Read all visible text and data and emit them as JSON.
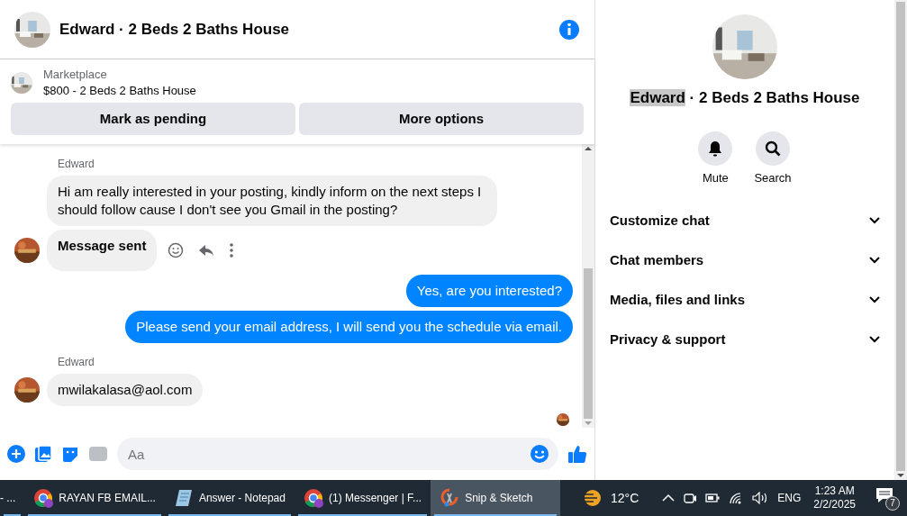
{
  "conversation": {
    "title": "Edward · 2 Beds 2 Baths House",
    "listing": {
      "source": "Marketplace",
      "summary": "$800 - 2 Beds 2 Baths House"
    },
    "buttons": [
      "Mark as pending",
      "More options"
    ]
  },
  "messages": [
    {
      "kind": "received",
      "sender": "Edward",
      "avatar": false,
      "actions": false,
      "text": "Hi am really interested in your posting, kindly inform on the next steps I should follow cause I don't see you Gmail in the  posting?"
    },
    {
      "kind": "received_bold",
      "avatar": true,
      "actions": true,
      "text": "Message sent"
    },
    {
      "kind": "sent",
      "text": "Yes, are you interested?"
    },
    {
      "kind": "sent",
      "text": "Please send your email address, I will send you the schedule via email."
    },
    {
      "kind": "received",
      "sender": "Edward",
      "avatar": true,
      "actions": false,
      "text": "mwilakalasa@aol.com"
    }
  ],
  "seen": true,
  "composer": {
    "placeholder": "Aa"
  },
  "details": {
    "name": "Edward",
    "name_selected": true,
    "rest": " · 2 Beds 2 Baths House",
    "actions": [
      {
        "label": "Mute",
        "kind": "bell"
      },
      {
        "label": "Search",
        "kind": "search"
      }
    ],
    "sections": [
      {
        "label": "Customize chat",
        "expanded": false
      },
      {
        "label": "Chat members",
        "expanded": false
      },
      {
        "label": "Media, files and links",
        "expanded": false
      },
      {
        "label": "Privacy & support",
        "expanded": false
      }
    ]
  },
  "taskbar": {
    "items": [
      {
        "label": "- ...",
        "kind": "plain",
        "selected": false,
        "running": true
      },
      {
        "label": "RAYAN FB EMAIL...",
        "kind": "browser",
        "selected": false,
        "running": true
      },
      {
        "label": "Answer - Notepad",
        "kind": "notepad",
        "selected": false,
        "running": true
      },
      {
        "label": "(1) Messenger | F...",
        "kind": "browser",
        "selected": false,
        "running": true
      },
      {
        "label": "Snip & Sketch",
        "kind": "scissors",
        "selected": true,
        "running": true
      }
    ],
    "temperature": "12°C",
    "language": "ENG",
    "time": "1:23 AM",
    "date": "2/2/2025",
    "notifications": "7"
  }
}
